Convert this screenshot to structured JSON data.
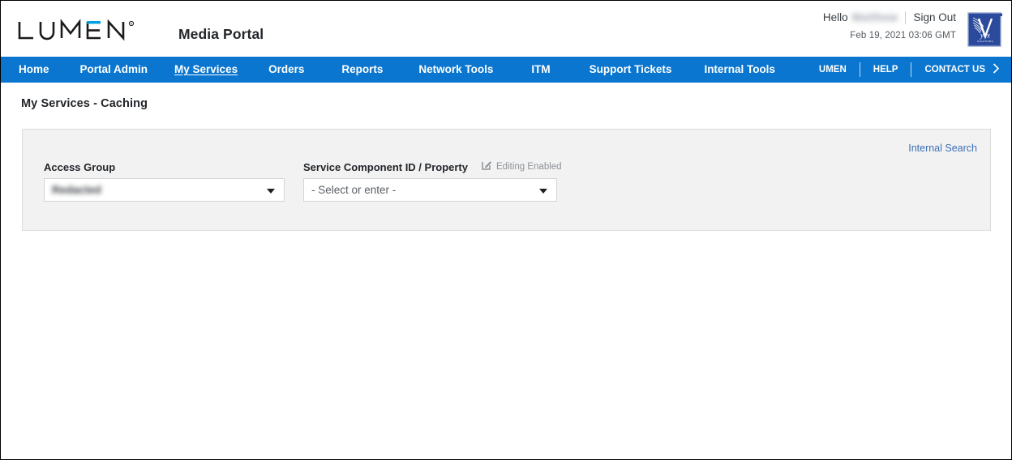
{
  "brand": {
    "logo_text": "LUMEN",
    "logo_registered": "®",
    "app_title": "Media Portal",
    "secondary_logo": "vyvx-logo",
    "accent_blue": "#00a1e0",
    "nav_blue": "#0a76cf"
  },
  "header": {
    "hello_label": "Hello",
    "user_name": "Matthew",
    "sign_out": "Sign Out",
    "timestamp": "Feb 19, 2021 03:06 GMT"
  },
  "nav": {
    "primary": [
      {
        "label": "Home",
        "active": false
      },
      {
        "label": "Portal Admin",
        "active": false
      },
      {
        "label": "My Services",
        "active": true
      },
      {
        "label": "Orders",
        "active": false
      },
      {
        "label": "Reports",
        "active": false
      },
      {
        "label": "Network Tools",
        "active": false
      },
      {
        "label": "ITM",
        "active": false
      },
      {
        "label": "Support Tickets",
        "active": false
      },
      {
        "label": "Internal Tools",
        "active": false
      }
    ],
    "utility": [
      {
        "label": "UMEN"
      },
      {
        "label": "HELP"
      },
      {
        "label": "CONTACT US"
      }
    ],
    "contact_chevron": "chevron-right-icon"
  },
  "page": {
    "title": "My Services - Caching"
  },
  "panel": {
    "internal_search": "Internal Search",
    "access_group": {
      "label": "Access Group",
      "value": "Redacted",
      "redacted": true
    },
    "service_component": {
      "label": "Service Component ID / Property",
      "editing_icon": "edit-pencil-icon",
      "editing_status": "Editing Enabled",
      "placeholder": "- Select or enter -",
      "value": "- Select or enter -"
    }
  }
}
